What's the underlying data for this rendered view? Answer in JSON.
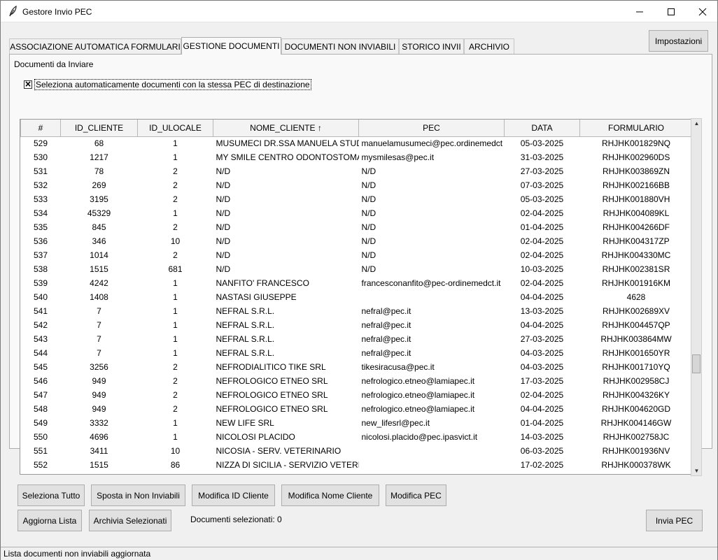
{
  "window": {
    "title": "Gestore Invio PEC"
  },
  "toolbar": {
    "settings_label": "Impostazioni"
  },
  "tabs": [
    {
      "label": "ASSOCIAZIONE AUTOMATICA FORMULARI"
    },
    {
      "label": "GESTIONE DOCUMENTI"
    },
    {
      "label": "DOCUMENTI NON INVIABILI"
    },
    {
      "label": "STORICO INVII"
    },
    {
      "label": "ARCHIVIO"
    }
  ],
  "panel": {
    "title": "Documenti da Inviare",
    "auto_select_label": "Seleziona automaticamente documenti con la stessa PEC di destinazione",
    "auto_select_checked": "🗙"
  },
  "table": {
    "columns": [
      "#",
      "ID_CLIENTE",
      "ID_ULOCALE",
      "NOME_CLIENTE ↑",
      "PEC",
      "DATA",
      "FORMULARIO"
    ],
    "rows": [
      [
        "529",
        "68",
        "1",
        "MUSUMECI DR.SSA  MANUELA STUDIO",
        "manuelamusumeci@pec.ordinemedct",
        "05-03-2025",
        "RHJHK001829NQ"
      ],
      [
        "530",
        "1217",
        "1",
        "MY SMILE CENTRO ODONTOSTOMAT",
        "mysmilesas@pec.it",
        "31-03-2025",
        "RHJHK002960DS"
      ],
      [
        "531",
        "78",
        "2",
        "N/D",
        "N/D",
        "27-03-2025",
        "RHJHK003869ZN"
      ],
      [
        "532",
        "269",
        "2",
        "N/D",
        "N/D",
        "07-03-2025",
        "RHJHK002166BB"
      ],
      [
        "533",
        "3195",
        "2",
        "N/D",
        "N/D",
        "05-03-2025",
        "RHJHK001880VH"
      ],
      [
        "534",
        "45329",
        "1",
        "N/D",
        "N/D",
        "02-04-2025",
        "RHJHK004089KL"
      ],
      [
        "535",
        "845",
        "2",
        "N/D",
        "N/D",
        "01-04-2025",
        "RHJHK004266DF"
      ],
      [
        "536",
        "346",
        "10",
        "N/D",
        "N/D",
        "02-04-2025",
        "RHJHK004317ZP"
      ],
      [
        "537",
        "1014",
        "2",
        "N/D",
        "N/D",
        "02-04-2025",
        "RHJHK004330MC"
      ],
      [
        "538",
        "1515",
        "681",
        "N/D",
        "N/D",
        "10-03-2025",
        "RHJHK002381SR"
      ],
      [
        "539",
        "4242",
        "1",
        "NANFITO' FRANCESCO",
        "francesconanfito@pec-ordinemedct.it",
        "02-04-2025",
        "RHJHK001916KM"
      ],
      [
        "540",
        "1408",
        "1",
        "NASTASI  GIUSEPPE",
        "",
        "04-04-2025",
        "4628"
      ],
      [
        "541",
        "7",
        "1",
        "NEFRAL S.R.L.",
        "nefral@pec.it",
        "13-03-2025",
        "RHJHK002689XV"
      ],
      [
        "542",
        "7",
        "1",
        "NEFRAL S.R.L.",
        "nefral@pec.it",
        "04-04-2025",
        "RHJHK004457QP"
      ],
      [
        "543",
        "7",
        "1",
        "NEFRAL S.R.L.",
        "nefral@pec.it",
        "27-03-2025",
        "RHJHK003864MW"
      ],
      [
        "544",
        "7",
        "1",
        "NEFRAL S.R.L.",
        "nefral@pec.it",
        "04-03-2025",
        "RHJHK001650YR"
      ],
      [
        "545",
        "3256",
        "2",
        "NEFRODIALITICO TIKE SRL",
        "tikesiracusa@pec.it",
        "04-03-2025",
        "RHJHK001710YQ"
      ],
      [
        "546",
        "949",
        "2",
        "NEFROLOGICO ETNEO SRL",
        "nefrologico.etneo@lamiapec.it",
        "17-03-2025",
        "RHJHK002958CJ"
      ],
      [
        "547",
        "949",
        "2",
        "NEFROLOGICO ETNEO SRL",
        "nefrologico.etneo@lamiapec.it",
        "02-04-2025",
        "RHJHK004326KY"
      ],
      [
        "548",
        "949",
        "2",
        "NEFROLOGICO ETNEO SRL",
        "nefrologico.etneo@lamiapec.it",
        "04-04-2025",
        "RHJHK004620GD"
      ],
      [
        "549",
        "3332",
        "1",
        "NEW LIFE SRL",
        "new_lifesrl@pec.it",
        "01-04-2025",
        "RHJHK004146GW"
      ],
      [
        "550",
        "4696",
        "1",
        "NICOLOSI PLACIDO",
        "nicolosi.placido@pec.ipasvict.it",
        "14-03-2025",
        "RHJHK002758JC"
      ],
      [
        "551",
        "3411",
        "10",
        "NICOSIA - SERV. VETERINARIO",
        "",
        "06-03-2025",
        "RHJHK001936NV"
      ],
      [
        "552",
        "1515",
        "86",
        "NIZZA DI SICILIA - SERVIZIO VETERINA",
        "",
        "17-02-2025",
        "RHJHK000378WK"
      ]
    ]
  },
  "buttons": {
    "select_all": "Seleziona Tutto",
    "move_non_sendable": "Sposta in Non Inviabili",
    "edit_client_id": "Modifica ID Cliente",
    "edit_client_name": "Modifica Nome Cliente",
    "edit_pec": "Modifica PEC",
    "refresh_list": "Aggiorna Lista",
    "archive_selected": "Archivia Selezionati",
    "send_pec": "Invia PEC"
  },
  "selection": {
    "count_label": "Documenti selezionati: 0"
  },
  "status": {
    "text": "Lista documenti non inviabili aggiornata"
  },
  "icons": {
    "app": "feather-icon",
    "minimize": "minimize-icon",
    "maximize": "maximize-icon",
    "close": "close-icon",
    "scroll_up": "scroll-up-arrow-icon",
    "scroll_down": "scroll-down-arrow-icon"
  },
  "colors": {
    "window_bg": "#f0f0f0",
    "table_bg": "#ffffff",
    "header_bg": "#f3f3f3",
    "button_bg": "#e1e1e1"
  }
}
